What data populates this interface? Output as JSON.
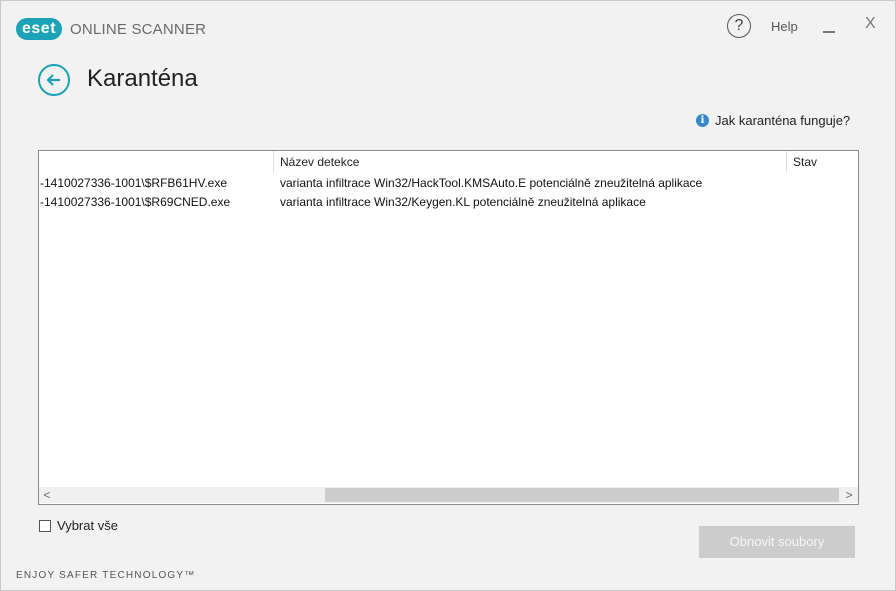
{
  "app": {
    "logo_text": "eset",
    "product_name": "ONLINE SCANNER",
    "help_glyph": "?",
    "help_label": "Help",
    "minimize_icon": "minimize-icon",
    "close_glyph": "X"
  },
  "header": {
    "title": "Karanténa",
    "back_icon": "back-arrow-icon",
    "info_glyph": "i",
    "info_link": "Jak karanténa funguje?"
  },
  "table": {
    "columns": [
      "",
      "Název detekce",
      "Stav"
    ],
    "rows": [
      {
        "file": "-1410027336-1001\\$RFB61HV.exe",
        "detection": "varianta infiltrace Win32/HackTool.KMSAuto.E potenciálně zneužitelná aplikace",
        "status": ""
      },
      {
        "file": "-1410027336-1001\\$R69CNED.exe",
        "detection": "varianta infiltrace Win32/Keygen.KL potenciálně zneužitelná aplikace",
        "status": ""
      }
    ],
    "scroll_left_glyph": "<",
    "scroll_right_glyph": ">"
  },
  "footer": {
    "select_all_label": "Vybrat vše",
    "select_all_checked": false,
    "restore_button": "Obnovit soubory",
    "restore_enabled": false,
    "tagline": "ENJOY SAFER TECHNOLOGY™"
  },
  "colors": {
    "accent": "#1ca2b6",
    "info": "#3b86c6",
    "window_bg": "#f2f2f2",
    "disabled_button": "#cccccc"
  }
}
